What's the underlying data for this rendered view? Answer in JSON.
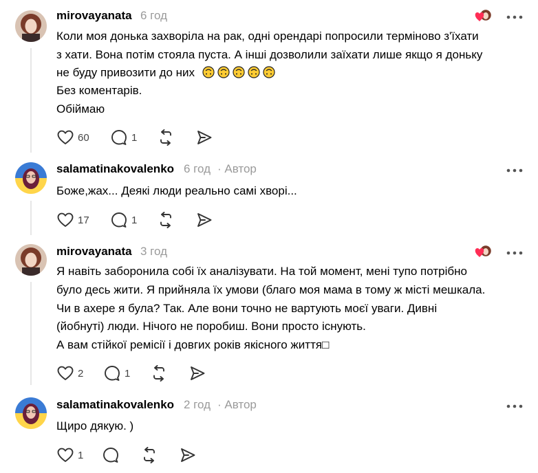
{
  "comments": [
    {
      "username": "mirovayanata",
      "time": "6 год",
      "author": "",
      "lines": [
        "Коли моя донька захворіла на рак, одні орендарі попросили терміново з'їхати",
        "з хати. Вона потім стояла пуста. А інші дозволили заїхати лише якщо я доньку",
        "не буду привозити до них",
        "Без коментарів.",
        "Обіймаю"
      ],
      "likes": "60",
      "replies": "1"
    },
    {
      "username": "salamatinakovalenko",
      "time": "6 год",
      "author": "· Автор",
      "lines": [
        "Боже,жах... Деякі люди реально самі хворі..."
      ],
      "likes": "17",
      "replies": "1"
    },
    {
      "username": "mirovayanata",
      "time": "3 год",
      "author": "",
      "lines": [
        "Я навіть заборонила собі їх аналізувати. На той момент, мені тупо потрібно",
        "було десь жити. Я прийняла їх умови (благо моя мама в тому ж місті мешкала.",
        "Чи в ахере я була? Так. Але вони точно не вартують моєї уваги. Дивні",
        "(йобнуті) люди. Нічого не поробиш. Вони просто існують.",
        "А вам стійкої ремісії і довгих років якісного життя□"
      ],
      "likes": "2",
      "replies": "1"
    },
    {
      "username": "salamatinakovalenko",
      "time": "2 год",
      "author": "· Автор",
      "lines": [
        "Щиро дякую. )"
      ],
      "likes": "1",
      "replies": ""
    }
  ],
  "icons": {
    "like": "heart-icon",
    "reply": "comment-bubble-icon",
    "repost": "repost-icon",
    "share": "share-icon",
    "more": "more-dots-icon",
    "emoji": "upside-down-face-emoji"
  },
  "colors": {
    "muted": "#9a9a9a",
    "heart": "#ff2d55",
    "thread": "#e6e6e6"
  }
}
